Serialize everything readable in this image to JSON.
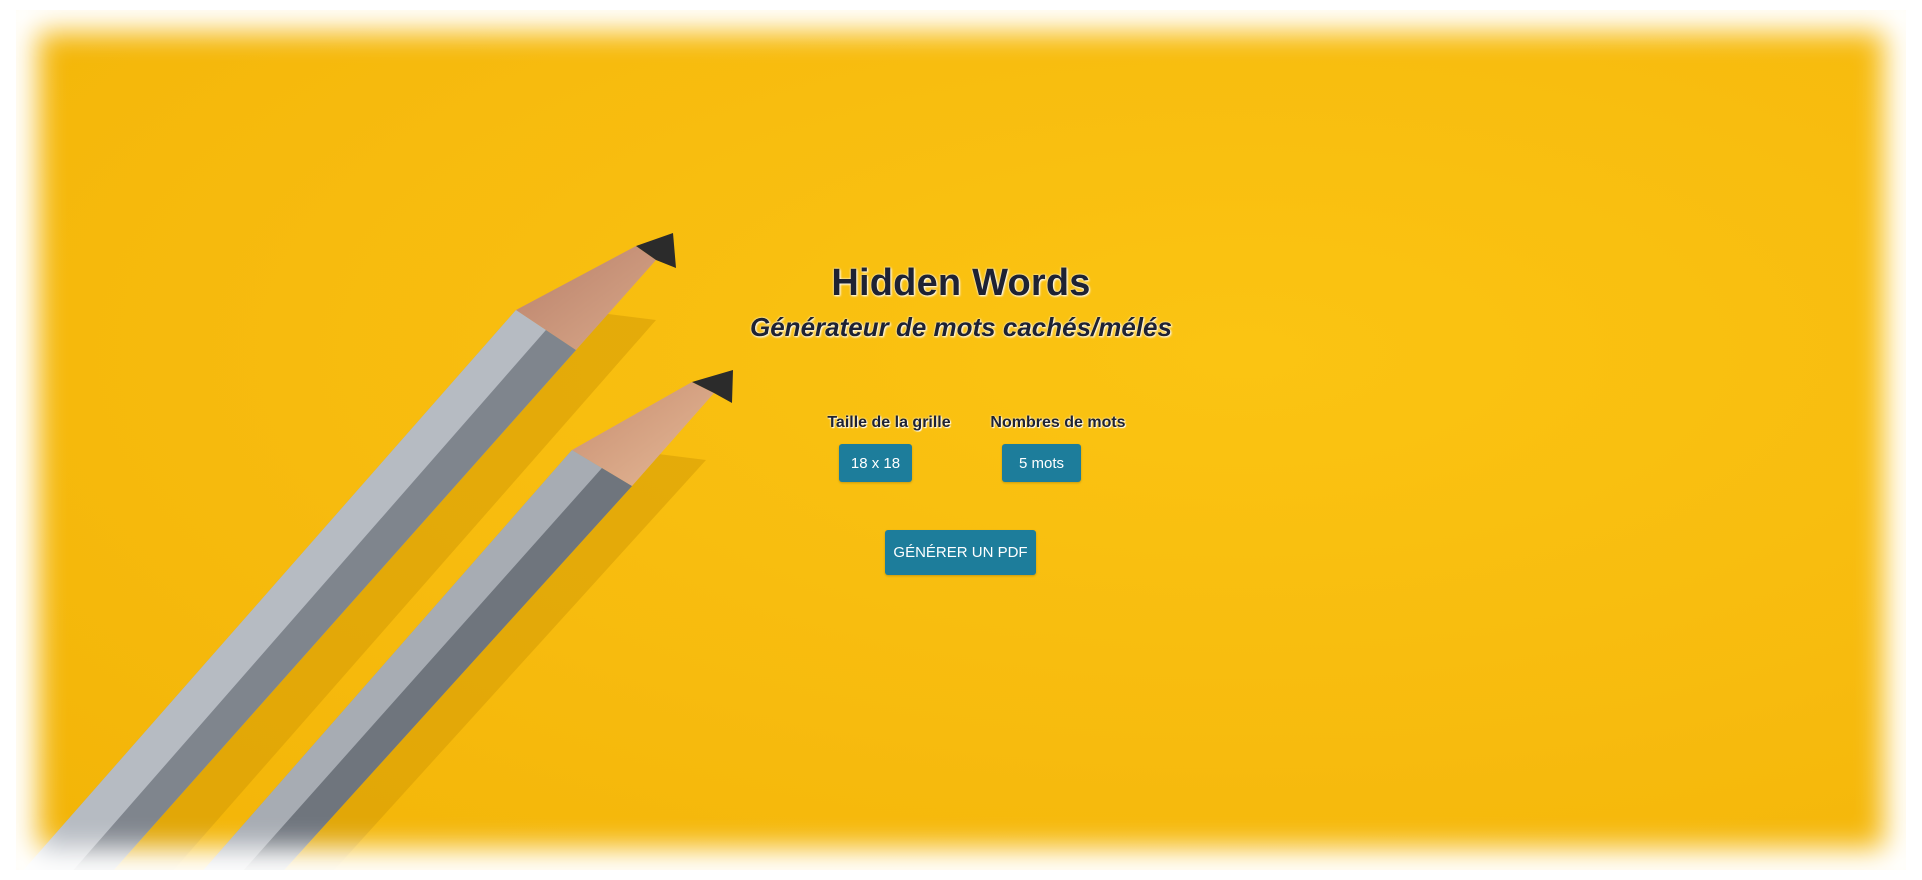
{
  "header": {
    "title": "Hidden Words",
    "subtitle": "Générateur de mots cachés/mélés"
  },
  "options": {
    "grid_size_label": "Taille de la grille",
    "grid_size_value": "18 x 18",
    "word_count_label": "Nombres de mots",
    "word_count_value": "5 mots"
  },
  "actions": {
    "generate_pdf_label": "GÉNÉRER UN PDF"
  },
  "colors": {
    "background": "#f8bd10",
    "button": "#1d7d9b",
    "text": "#1e2233"
  }
}
